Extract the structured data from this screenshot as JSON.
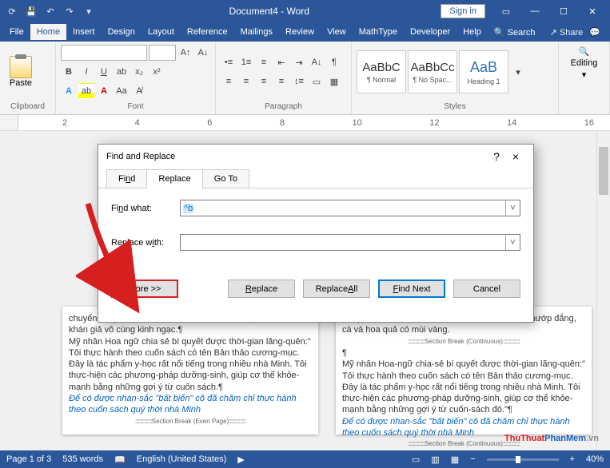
{
  "titlebar": {
    "doc_title": "Document4 - Word",
    "signin": "Sign in"
  },
  "menu": {
    "file": "File",
    "home": "Home",
    "insert": "Insert",
    "design": "Design",
    "layout": "Layout",
    "references": "Reference",
    "mailings": "Mailings",
    "review": "Review",
    "view": "View",
    "mathtype": "MathType",
    "developer": "Developer",
    "help": "Help",
    "search": "Search",
    "share": "Share"
  },
  "ribbon": {
    "clipboard": {
      "label": "Clipboard",
      "paste": "Paste"
    },
    "font": {
      "label": "Font",
      "bold": "B",
      "italic": "I",
      "underline": "U"
    },
    "paragraph": {
      "label": "Paragraph"
    },
    "styles": {
      "label": "Styles",
      "s1_preview": "AaBbC",
      "s1_name": "¶ Normal",
      "s2_preview": "AaBbCc",
      "s2_name": "¶ No Spac...",
      "s3_preview": "AaB",
      "s3_name": "Heading 1"
    },
    "editing": {
      "label": "Editing"
    }
  },
  "ruler": {
    "marks": [
      "2",
      "4",
      "6",
      "8",
      "10",
      "12",
      "14",
      "16"
    ]
  },
  "dialog": {
    "title": "Find and Replace",
    "tab_find": "Find",
    "tab_replace": "Replace",
    "tab_goto": "Go To",
    "find_label": "Find what:",
    "find_accel": "n",
    "find_value": "^b",
    "replace_label": "Replace with:",
    "replace_accel": "i",
    "replace_value": "",
    "more": "More >>",
    "replace_btn": "Replace",
    "replace_all": "Replace All",
    "find_next": "Find Next",
    "cancel": "Cancel",
    "help": "?",
    "close": "×"
  },
  "doc": {
    "p1_line1": "chuyển chuyển và mềm mại. Sự dẻo dai, vẻ đẹp của cô khiến khán giả vô cùng kinh ngạc.¶",
    "p1_line2": "Mỹ nhân Hoa ngữ chia sẻ bí quyết được thời-gian lãng-quên:\" Tôi thực hành theo cuốn sách có tên Bản thảo cương-mục. Đây là tác phẩm y-học rất nổi tiếng trong nhiều nhà Minh. Tôi thực-hiện các phương-pháp dưỡng-sinh, giúp cơ thể khỏe-mạnh bằng những gợi ý từ cuốn sách.¶",
    "p1_link": "Để có được nhan-sắc \"bất biến\" cô đã chăm chỉ thực hành theo cuốn sách quý thời nhà Minh",
    "p1_break": "Section Break (Even Page)",
    "p2_line1": "Thay vào đó, cô ăn rất nhiều rau củ, đặc biệt là mướp đắng, cà và hoa quả có mùi vàng.",
    "p2_break1": "Section Break (Continuous)",
    "p2_para": "¶",
    "p2_line2": "Mỹ nhân Hoa-ngữ chia-sẻ bí quyết được thời-gian lãng-quên:\" Tôi thực hành theo cuốn sách có tên Bản thảo cương-mục. Đây là tác phẩm y-học rất nổi tiếng trong nhiều nhà Minh. Tôi thực-hiện các phương-pháp dưỡng-sinh, giúp cơ thể khỏe-mạnh bằng những gợi ý từ cuốn-sách đó.\"¶",
    "p2_link": "Để có được nhan-sắc \"bất biến\" cô đã chăm chỉ thực hành theo cuốn sách quý thời nhà Minh",
    "p2_break2": "Section Break (Continuous)"
  },
  "status": {
    "page": "Page 1 of 3",
    "words": "535 words",
    "lang": "English (United States)",
    "zoom": "40%"
  },
  "watermark": {
    "a": "ThuThuat",
    "b": "PhanMem",
    "c": ".vn"
  }
}
